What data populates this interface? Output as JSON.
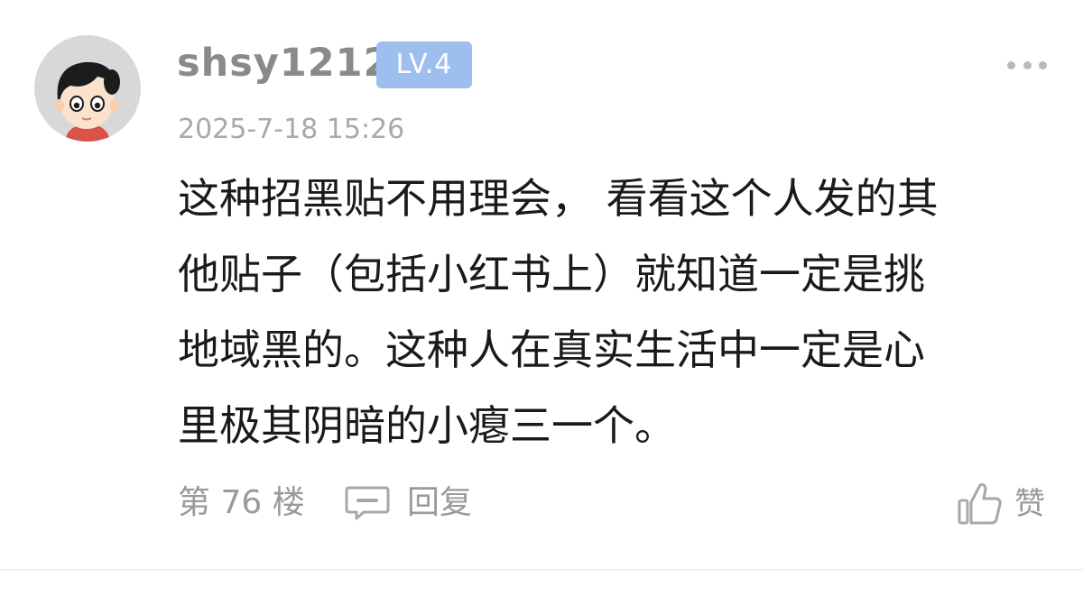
{
  "post": {
    "author": {
      "username": "shsy1212",
      "level": "LV.4",
      "avatar": "cartoon-boy-avatar"
    },
    "timestamp": "2025-7-18 15:26",
    "content_lines": [
      "这种招黑贴不用理会， 看看这个人发的其",
      "他贴子（包括小红书上）就知道一定是挑",
      "地域黑的。这种人在真实生活中一定是心",
      "里极其阴暗的小瘪三一个。"
    ],
    "footer": {
      "floor": "第 76 楼",
      "reply_label": "回复",
      "like_label": "赞"
    },
    "icons": {
      "more": "more-dots-icon",
      "reply": "comment-icon",
      "like": "thumbs-up-icon"
    },
    "colors": {
      "level_badge_bg": "#9dbfee",
      "username": "#8a8a8a",
      "meta_text": "#a9a9a9",
      "body_text": "#1a1a1a",
      "avatar_bg": "#d8d8d8"
    }
  }
}
